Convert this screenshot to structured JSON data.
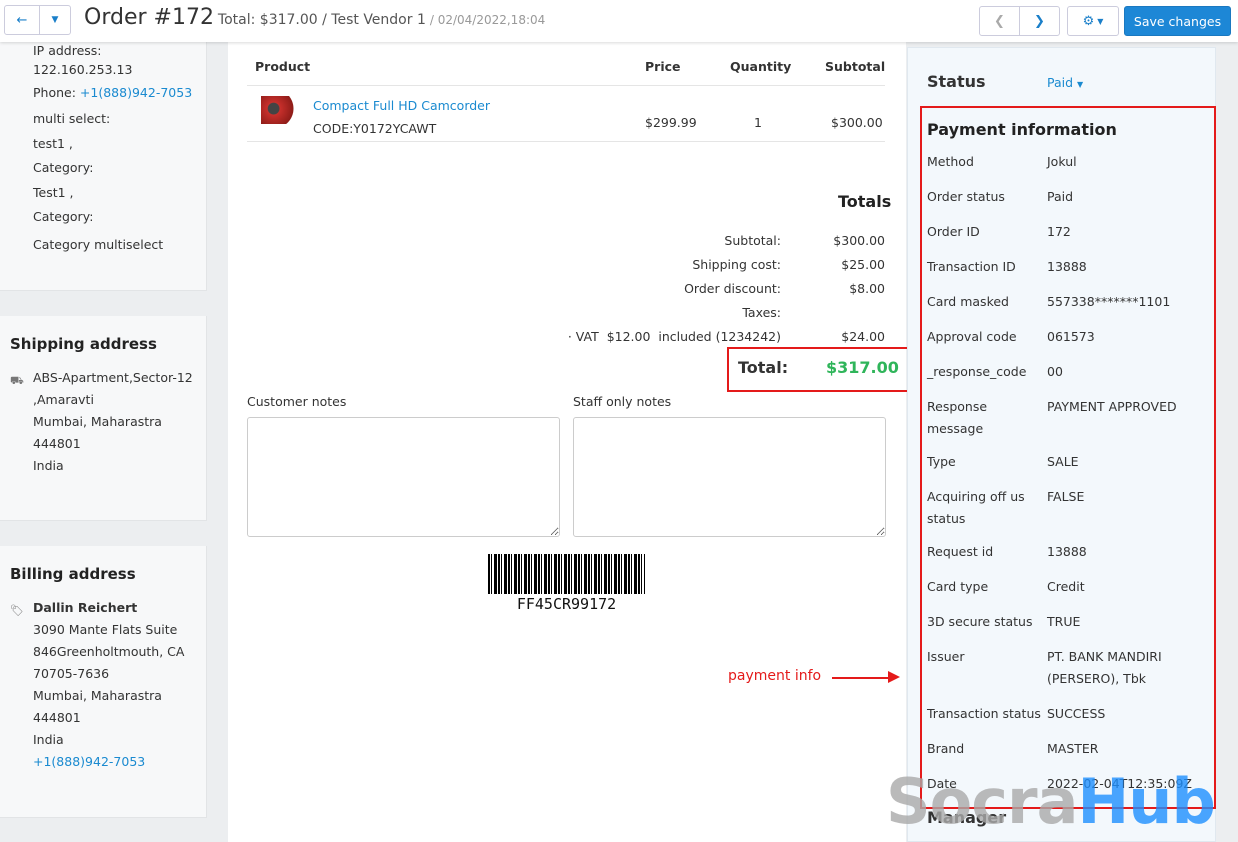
{
  "header": {
    "title": "Order #172",
    "summary": "Total: $317.00 / Test Vendor 1",
    "date": "/ 02/04/2022,18:04",
    "save_label": "Save changes"
  },
  "customer": {
    "ip_label": "IP address:",
    "ip": "122.160.253.13",
    "phone_label": "Phone:",
    "phone": "+1(888)942-7053",
    "lines": [
      "multi select:",
      "test1 ,",
      "Category:",
      "Test1 ,",
      "Category:",
      "Category multiselect"
    ]
  },
  "shipping": {
    "title": "Shipping address",
    "lines": [
      "ABS-Apartment,Sector-12",
      ",Amaravti",
      "Mumbai, Maharastra",
      "444801",
      "India"
    ]
  },
  "billing": {
    "title": "Billing address",
    "name": "Dallin Reichert",
    "lines": [
      "3090 Mante Flats Suite",
      "846Greenholtmouth, CA",
      "70705-7636",
      "Mumbai, Maharastra",
      "444801",
      "India"
    ],
    "phone": "+1(888)942-7053"
  },
  "products": {
    "headers": [
      "Product",
      "Price",
      "Quantity",
      "Subtotal"
    ],
    "items": [
      {
        "name": "Compact Full HD Camcorder",
        "code": "CODE:Y0172YCAWT",
        "price": "$299.99",
        "qty": "1",
        "subtotal": "$300.00"
      }
    ]
  },
  "totals": {
    "title": "Totals",
    "rows": [
      {
        "label": "Subtotal:",
        "value": "$300.00"
      },
      {
        "label": "Shipping cost:",
        "value": "$25.00"
      },
      {
        "label": "Order discount:",
        "value": "$8.00"
      },
      {
        "label": "Taxes:",
        "value": ""
      },
      {
        "label": "· VAT  $12.00  included (1234242)",
        "value": "$24.00"
      }
    ],
    "total_label": "Total:",
    "total_value": "$317.00"
  },
  "notes": {
    "customer_label": "Customer notes",
    "staff_label": "Staff only notes"
  },
  "barcode": "FF45CR99172",
  "annotation": "payment info",
  "status": {
    "label": "Status",
    "value": "Paid"
  },
  "payment": {
    "title": "Payment information",
    "rows": [
      {
        "k": "Method",
        "v": "Jokul"
      },
      {
        "k": "Order status",
        "v": "Paid"
      },
      {
        "k": "Order ID",
        "v": "172"
      },
      {
        "k": "Transaction ID",
        "v": "13888"
      },
      {
        "k": "Card masked",
        "v": "557338*******1101"
      },
      {
        "k": "Approval code",
        "v": "061573"
      },
      {
        "k": "_response_code",
        "v": "00"
      },
      {
        "k": "Response message",
        "v": "PAYMENT APPROVED"
      },
      {
        "k": "Type",
        "v": "SALE"
      },
      {
        "k": "Acquiring off us status",
        "v": "FALSE"
      },
      {
        "k": "Request id",
        "v": "13888"
      },
      {
        "k": "Card type",
        "v": "Credit"
      },
      {
        "k": "3D secure status",
        "v": "TRUE"
      },
      {
        "k": "Issuer",
        "v": "PT. BANK MANDIRI (PERSERO), Tbk"
      },
      {
        "k": "Transaction status",
        "v": "SUCCESS"
      },
      {
        "k": "Brand",
        "v": "MASTER"
      },
      {
        "k": "Date",
        "v": "2022-02-04T12:35:09Z"
      }
    ]
  },
  "manager_label": "Manager",
  "watermark": "SocraHub"
}
